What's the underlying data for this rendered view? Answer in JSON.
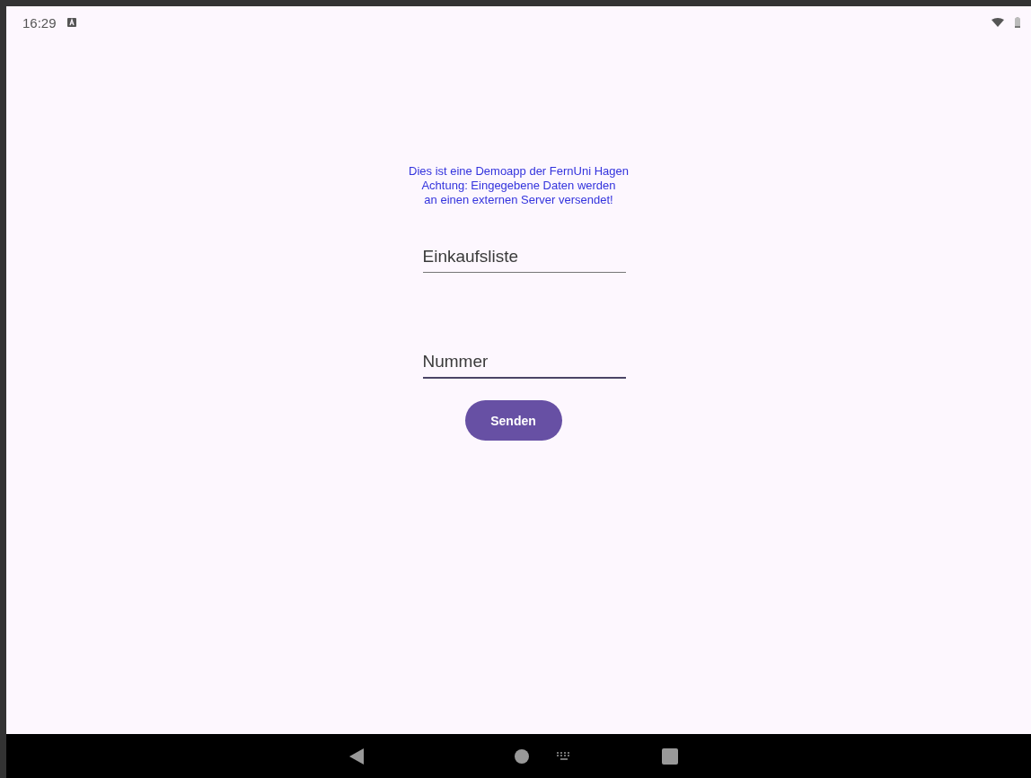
{
  "status_bar": {
    "time": "16:29"
  },
  "notice": [
    "Dies ist eine Demoapp der FernUni Hagen",
    "Achtung: Eingegebene Daten werden",
    "an einen externen Server versendet!"
  ],
  "fields": [
    {
      "placeholder": "Einkaufsliste",
      "focused": false
    },
    {
      "placeholder": "Nummer",
      "focused": true
    }
  ],
  "button": {
    "label": "Senden"
  }
}
